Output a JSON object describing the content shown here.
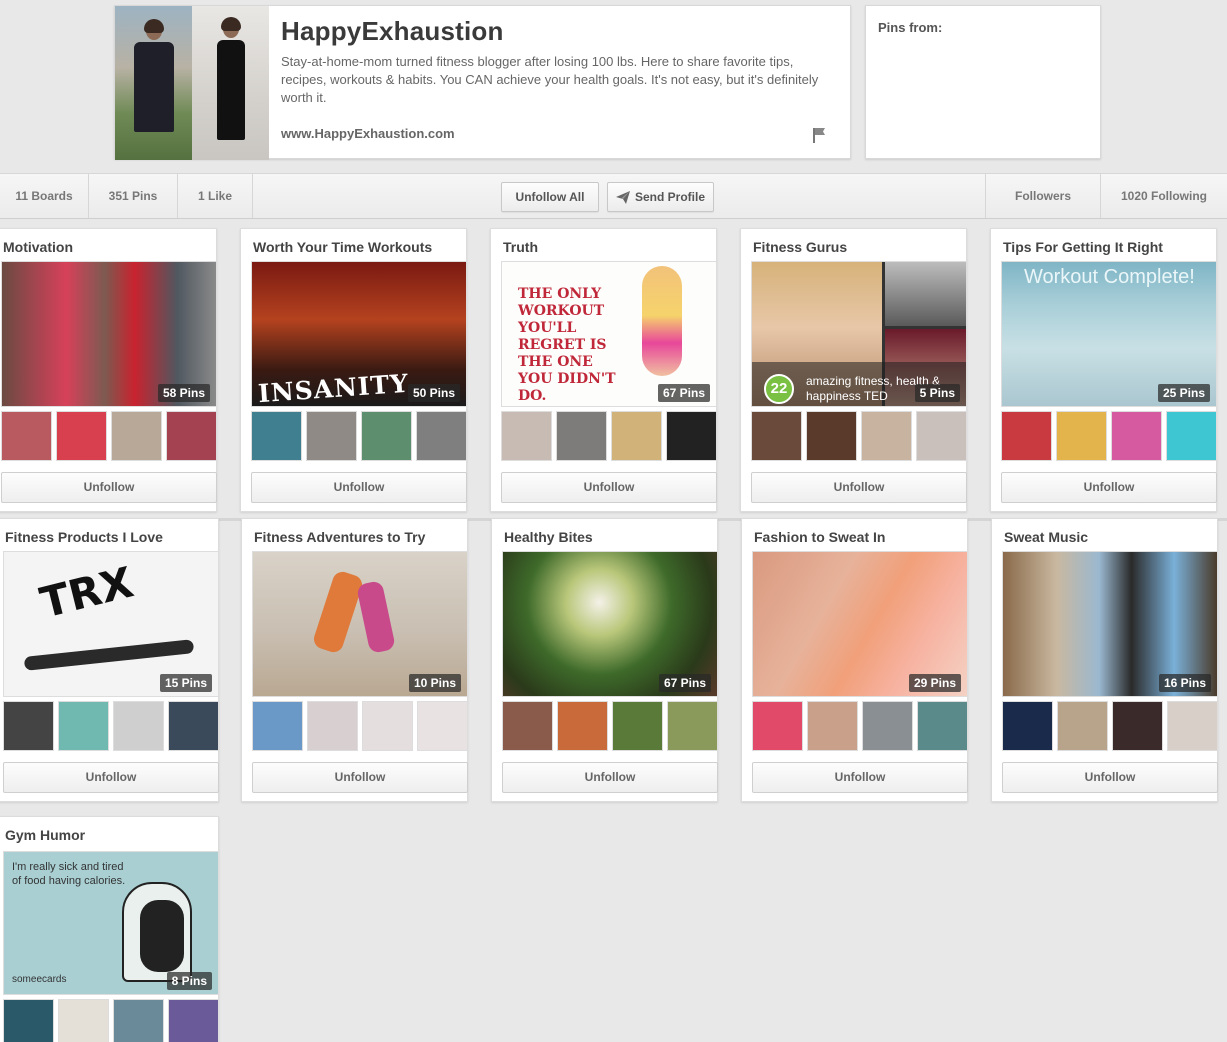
{
  "profile": {
    "name": "HappyExhaustion",
    "bio": "Stay-at-home-mom turned fitness blogger after losing 100 lbs. Here to share favorite tips, recipes, workouts & habits. You CAN achieve your health goals. It's not easy, but it's definitely worth it.",
    "website": "www.HappyExhaustion.com"
  },
  "pins_from": {
    "label": "Pins from:"
  },
  "stats": {
    "boards": "11 Boards",
    "pins": "351 Pins",
    "likes": "1 Like",
    "followers": "Followers",
    "following": "1020 Following"
  },
  "actions": {
    "unfollow_all": "Unfollow All",
    "send_profile": "Send Profile"
  },
  "unfollow_label": "Unfollow",
  "boards": [
    {
      "title": "Motivation",
      "pins": "58 Pins",
      "colors": [
        "#b85a5f",
        "#d8404f",
        "#b7a898",
        "#a44252"
      ]
    },
    {
      "title": "Worth Your Time Workouts",
      "pins": "50 Pins",
      "colors": [
        "#3f7f8f",
        "#8f8a86",
        "#5d8f6f",
        "#7f7f80"
      ],
      "cover_text": "INSANITY"
    },
    {
      "title": "Truth",
      "pins": "67 Pins",
      "colors": [
        "#c7bbb4",
        "#7d7c7a",
        "#d1b37a",
        "#222222"
      ],
      "cover_text": "THE ONLY WORKOUT YOU'LL REGRET IS THE ONE YOU DIDN'T DO."
    },
    {
      "title": "Fitness Gurus",
      "pins": "5 Pins",
      "colors": [
        "#6a4a3a",
        "#5a3a2a",
        "#c8b2a0",
        "#c9c0bb"
      ],
      "cover_text": "amazing fitness, health & happiness TED"
    },
    {
      "title": "Tips For Getting It Right",
      "pins": "25 Pins",
      "colors": [
        "#c83a3f",
        "#e3b34c",
        "#d65aa0",
        "#3ec6d3"
      ],
      "cover_text": "Workout Complete!"
    },
    {
      "title": "Fitness Products I Love",
      "pins": "15 Pins",
      "colors": [
        "#444444",
        "#6fb9b0",
        "#cfcfcf",
        "#3a4a5a"
      ],
      "cover_text": "TRX"
    },
    {
      "title": "Fitness Adventures to Try",
      "pins": "10 Pins",
      "colors": [
        "#6a99c8",
        "#d8d0d0",
        "#e4dede",
        "#e8e2e2"
      ]
    },
    {
      "title": "Healthy Bites",
      "pins": "67 Pins",
      "colors": [
        "#8a5a4a",
        "#c86a3a",
        "#5a7a3a",
        "#8a9a5a"
      ]
    },
    {
      "title": "Fashion to Sweat In",
      "pins": "29 Pins",
      "colors": [
        "#e24a6a",
        "#c9a08a",
        "#8a8f94",
        "#5a8a8a"
      ]
    },
    {
      "title": "Sweat Music",
      "pins": "16 Pins",
      "colors": [
        "#1a2a4a",
        "#b8a48a",
        "#3a2a2a",
        "#d8d0c8"
      ]
    },
    {
      "title": "Gym Humor",
      "pins": "8 Pins",
      "colors": [
        "#2a5a6a",
        "#e4e0d8",
        "#6a8a9a",
        "#6a5a9a"
      ],
      "cover_text": "I'm really sick and tired of food having calories.",
      "brand": "someecards"
    }
  ]
}
